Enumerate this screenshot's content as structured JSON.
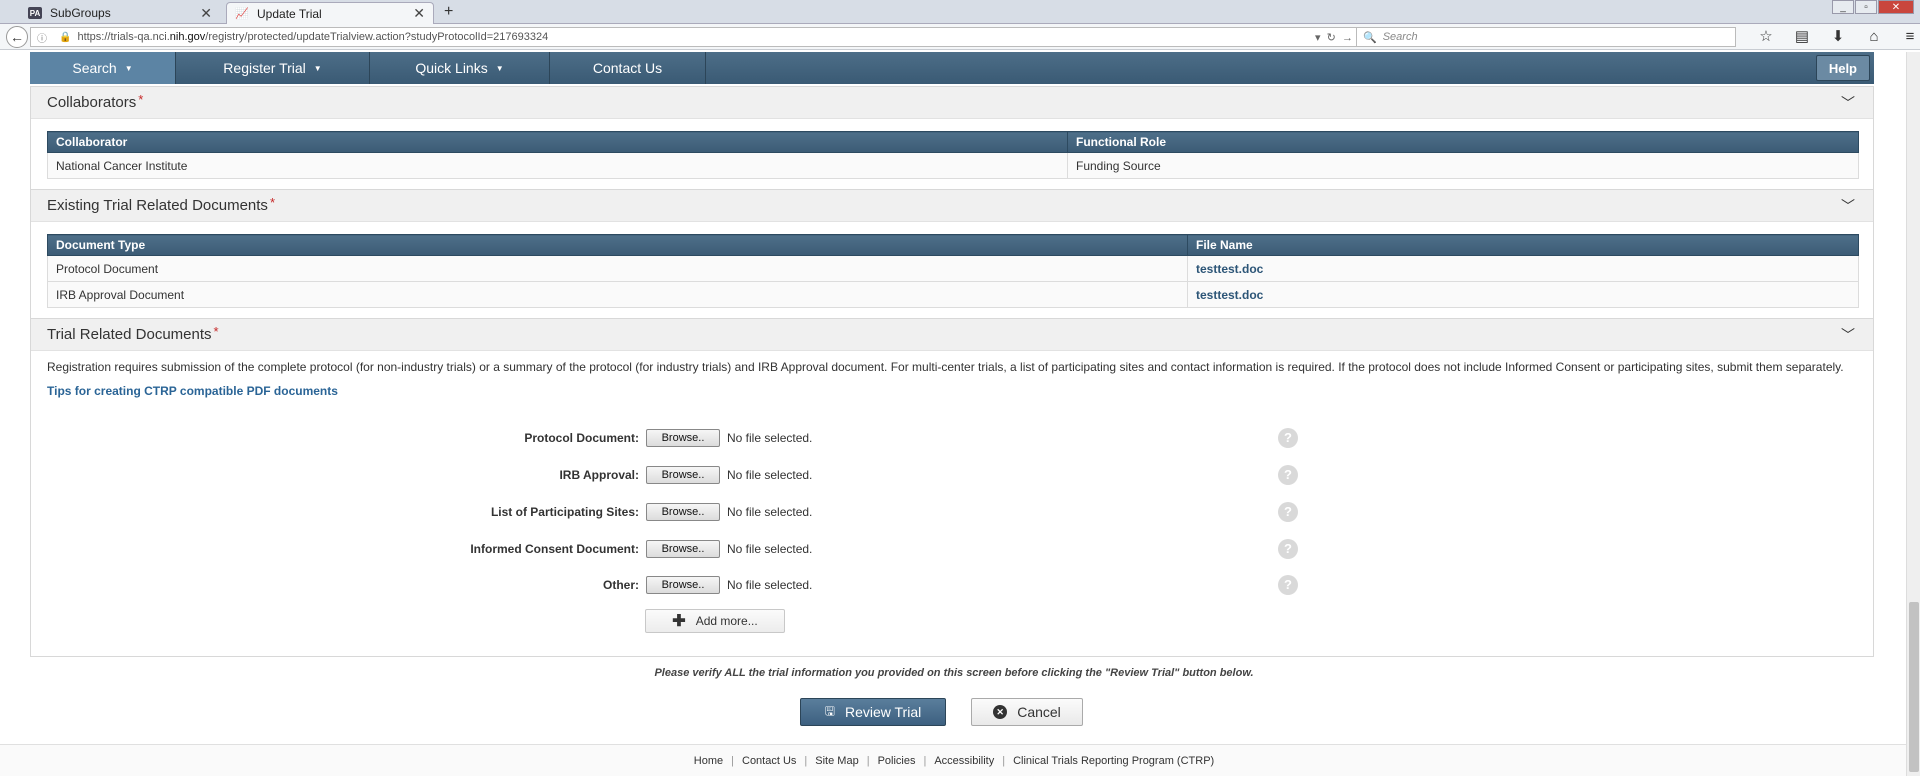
{
  "browser": {
    "tabs": [
      {
        "fav": "PA",
        "title": "SubGroups"
      },
      {
        "fav": "⏶",
        "title": "Update Trial"
      }
    ],
    "url_prefix": "https://trials-qa.nci.",
    "url_domain": "nih.gov",
    "url_suffix": "/registry/protected/updateTrialview.action?studyProtocolId=217693324",
    "search_placeholder": "Search"
  },
  "nav": {
    "items": [
      {
        "label": "Search",
        "caret": true
      },
      {
        "label": "Register Trial",
        "caret": true
      },
      {
        "label": "Quick Links",
        "caret": true
      },
      {
        "label": "Contact Us",
        "caret": false
      }
    ],
    "help": "Help"
  },
  "collaborators": {
    "title": "Collaborators",
    "required": "*",
    "columns": [
      "Collaborator",
      "Functional Role"
    ],
    "rows": [
      [
        "National Cancer Institute",
        "Funding Source"
      ]
    ]
  },
  "existing_docs": {
    "title": "Existing Trial Related Documents",
    "required": "*",
    "columns": [
      "Document Type",
      "File Name"
    ],
    "rows": [
      [
        "Protocol Document",
        "testtest.doc"
      ],
      [
        "IRB Approval Document",
        "testtest.doc"
      ]
    ]
  },
  "trial_docs": {
    "title": "Trial Related Documents ",
    "required": "*",
    "description": "Registration requires submission of the complete protocol (for non-industry trials) or a summary of the protocol (for industry trials) and IRB Approval document. For multi-center trials, a list of participating sites and contact information is required. If the protocol does not include Informed Consent or participating sites, submit them separately.",
    "tips_link": "Tips for creating CTRP compatible PDF documents",
    "browse_label": "Browse..",
    "no_file": "No file selected.",
    "help_glyph": "?",
    "fields": [
      {
        "label": "Protocol Document:"
      },
      {
        "label": "IRB Approval:"
      },
      {
        "label": "List of Participating Sites:"
      },
      {
        "label": "Informed Consent Document:"
      },
      {
        "label": "Other:"
      }
    ],
    "add_more": "Add more..."
  },
  "verify_text": "Please verify ALL the trial information you provided on this screen before clicking the \"Review Trial\" button below.",
  "buttons": {
    "review": "Review Trial",
    "cancel": "Cancel"
  },
  "footer": {
    "links": [
      "Home",
      "Contact Us",
      "Site Map",
      "Policies",
      "Accessibility",
      "Clinical Trials Reporting Program (CTRP)"
    ]
  }
}
